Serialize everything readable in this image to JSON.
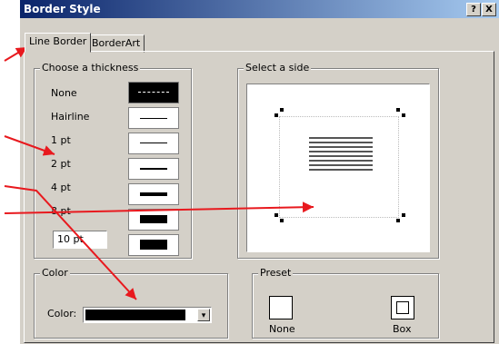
{
  "window": {
    "title": "Border Style",
    "help_btn": "?",
    "close_btn": "X"
  },
  "tabs": [
    {
      "label": "Line Border"
    },
    {
      "label": "BorderArt"
    }
  ],
  "thickness": {
    "label": "Choose a thickness",
    "items": [
      {
        "label": "None"
      },
      {
        "label": "Hairline"
      },
      {
        "label": "1 pt"
      },
      {
        "label": "2 pt"
      },
      {
        "label": "4 pt"
      },
      {
        "label": "8 pt"
      }
    ],
    "custom_value": "10 pt"
  },
  "side": {
    "label": "Select a side"
  },
  "color": {
    "group_label": "Color",
    "field_label": "Color:",
    "value_hex": "#000000",
    "dropdown_glyph": "▾"
  },
  "preset": {
    "label": "Preset",
    "items": [
      {
        "label": "None"
      },
      {
        "label": "Box"
      }
    ]
  },
  "colors": {
    "titlebar": "#0a246a",
    "dialog_bg": "#d4d0c8",
    "arrow": "#e8191e"
  }
}
